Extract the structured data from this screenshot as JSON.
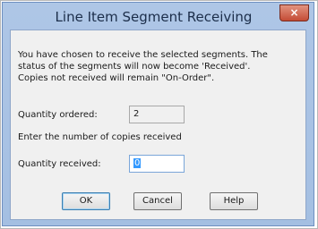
{
  "window": {
    "title": "Line Item Segment Receiving",
    "close_glyph": "×"
  },
  "message": {
    "lines": [
      "You have chosen to receive the selected segments. The",
      "status of the segments will now become 'Received'.",
      "Copies not received will remain \"On-Order\"."
    ]
  },
  "quantity_ordered": {
    "label": "Quantity ordered:",
    "value": "2"
  },
  "instruction": "Enter the number of copies received",
  "quantity_received": {
    "label": "Quantity received:",
    "value": "0"
  },
  "buttons": {
    "ok": "OK",
    "cancel": "Cancel",
    "help": "Help"
  },
  "colors": {
    "title_bar": "#aec6e6",
    "close_button": "#c44c36",
    "client_background": "#f0f0f0",
    "selection": "#3399ff"
  },
  "icons": {
    "close": "close-icon"
  }
}
